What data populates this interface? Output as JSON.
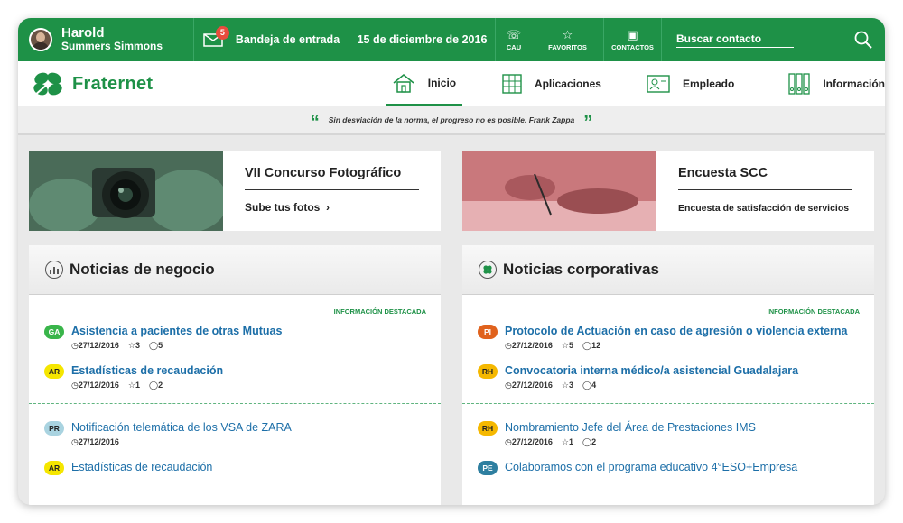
{
  "user": {
    "first_name": "Harold",
    "last_name": "Summers Simmons"
  },
  "topbar": {
    "inbox_count": "5",
    "inbox_label": "Bandeja de entrada",
    "date": "15 de diciembre de 2016",
    "cau_label": "CAU",
    "favorites_label": "FAVORITOS",
    "contacts_label": "CONTACTOS",
    "search_label": "Buscar contacto"
  },
  "brand": {
    "name": "Fraternet",
    "color": "#1e9147"
  },
  "nav": {
    "inicio": "Inicio",
    "aplicaciones": "Aplicaciones",
    "empleado": "Empleado",
    "informacion": "Información"
  },
  "quote": "Sin desviación de la norma, el progreso no es posible. Frank Zappa",
  "banners": [
    {
      "title": "VII Concurso Fotográfico",
      "subtitle": "Sube tus fotos"
    },
    {
      "title": "Encuesta SCC",
      "subtitle": "Encuesta de satisfacción de servicios"
    }
  ],
  "business_news": {
    "title": "Noticias de negocio",
    "featured_label": "INFORMACIÓN DESTACADA",
    "items": [
      {
        "tag": "GA",
        "title": "Asistencia a pacientes de otras Mutuas",
        "date": "27/12/2016",
        "stars": "3",
        "comments": "5"
      },
      {
        "tag": "AR",
        "title": "Estadísticas de recaudación",
        "date": "27/12/2016",
        "stars": "1",
        "comments": "2"
      },
      {
        "tag": "PR",
        "title": "Notificación telemática de los VSA de ZARA",
        "date": "27/12/2016"
      },
      {
        "tag": "AR",
        "title": "Estadísticas de recaudación"
      }
    ]
  },
  "corporate_news": {
    "title": "Noticias corporativas",
    "featured_label": "INFORMACIÓN DESTACADA",
    "items": [
      {
        "tag": "PI",
        "title": "Protocolo de Actuación en caso de agresión o violencia externa",
        "date": "27/12/2016",
        "stars": "5",
        "comments": "12"
      },
      {
        "tag": "RH",
        "title": "Convocatoria interna médico/a asistencial Guadalajara",
        "date": "27/12/2016",
        "stars": "3",
        "comments": "4"
      },
      {
        "tag": "RH",
        "title": "Nombramiento Jefe del Área de Prestaciones IMS",
        "date": "27/12/2016",
        "stars": "1",
        "comments": "2"
      },
      {
        "tag": "PE",
        "title": "Colaboramos con el programa educativo 4°ESO+Empresa"
      }
    ]
  },
  "tag_colors": {
    "GA": "#39b54a",
    "AR": "#f5e600",
    "PR": "#a9d3e0",
    "PI": "#e0621d",
    "RH": "#f5b800",
    "PE": "#2e7fa0"
  }
}
